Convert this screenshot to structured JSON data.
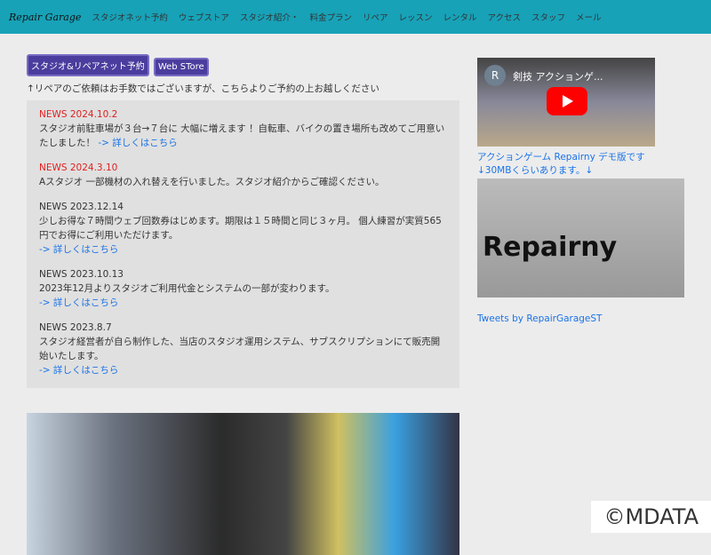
{
  "nav": {
    "logo": "Repair Garage",
    "items": [
      "スタジオネット予約",
      "ウェブストア",
      "スタジオ紹介・",
      "料金プラン",
      "リペア",
      "レッスン",
      "レンタル",
      "アクセス",
      "スタッフ",
      "メール"
    ]
  },
  "buttons": {
    "reserve": "スタジオ&リペアネット予約",
    "store": "Web STore"
  },
  "notice": "↑リペアのご依頼はお手数ではございますが、こちらよりご予約の上お越しください",
  "news": [
    {
      "date": "NEWS 2024.10.2",
      "text": "スタジオ前駐車場が３台→７台に 大幅に増えます ！自転車、バイクの置き場所も改めてご用意いたしました！",
      "link": "-> 詳しくはこちら"
    },
    {
      "date": "NEWS 2024.3.10",
      "text": "Aスタジオ 一部機材の入れ替えを行いました。スタジオ紹介からご確認ください。",
      "link": ""
    },
    {
      "date": "NEWS 2023.12.14",
      "text": "少しお得な７時間ウェブ回数券はじめます。期限は１５時間と同じ３ヶ月。 個人練習が実質565円でお得にご利用いただけます。",
      "link": "-> 詳しくはこちら"
    },
    {
      "date": "NEWS 2023.10.13",
      "text": "2023年12月よりスタジオご利用代金とシステムの一部が変わります。",
      "link": "-> 詳しくはこちら"
    },
    {
      "date": "NEWS 2023.8.7",
      "text": "スタジオ経営者が自ら制作した、当店のスタジオ運用システム、サブスクリプションにて販売開始いたします。",
      "link": "-> 詳しくはこちら"
    }
  ],
  "side": {
    "video_avatar": "R",
    "video_title": "剣技 アクションゲ...",
    "game_link": "アクションゲーム Repairny デモ版です",
    "size_note": "↓30MBくらいあります。↓",
    "banner_text": "Repairny",
    "tweets": "Tweets by RepairGarageST"
  },
  "watermark": "©MDATA"
}
